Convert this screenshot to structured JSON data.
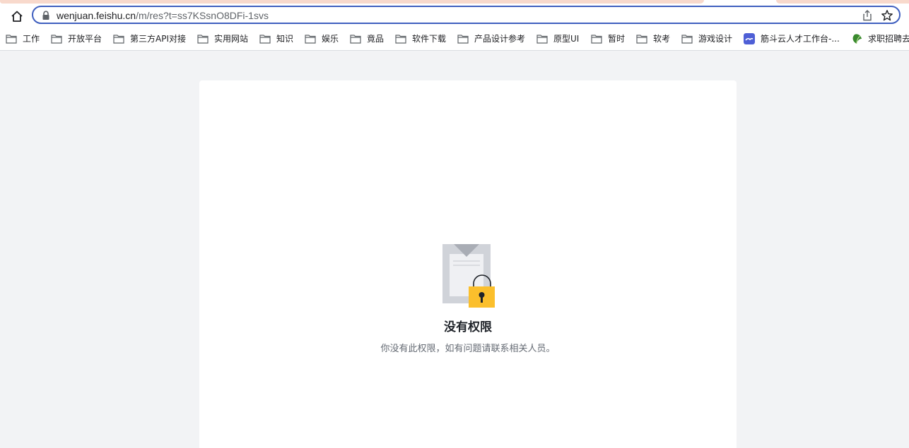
{
  "browser": {
    "url_host": "wenjuan.feishu.cn",
    "url_path": "/m/res?t=ss7KSsnO8DFi-1svs"
  },
  "bookmarks": [
    {
      "label": "工作",
      "icon": "folder-icon"
    },
    {
      "label": "开放平台",
      "icon": "folder-icon"
    },
    {
      "label": "第三方API对接",
      "icon": "folder-icon"
    },
    {
      "label": "实用网站",
      "icon": "folder-icon"
    },
    {
      "label": "知识",
      "icon": "folder-icon"
    },
    {
      "label": "娱乐",
      "icon": "folder-icon"
    },
    {
      "label": "竟品",
      "icon": "folder-icon"
    },
    {
      "label": "软件下载",
      "icon": "folder-icon"
    },
    {
      "label": "产品设计参考",
      "icon": "folder-icon"
    },
    {
      "label": "原型UI",
      "icon": "folder-icon"
    },
    {
      "label": "暂时",
      "icon": "folder-icon"
    },
    {
      "label": "软考",
      "icon": "folder-icon"
    },
    {
      "label": "游戏设计",
      "icon": "folder-icon"
    },
    {
      "label": "筋斗云人才工作台-...",
      "icon": "jindouyun-favicon",
      "color": "#4e5fd6"
    },
    {
      "label": "求职招聘去",
      "icon": "leaf-favicon",
      "color": "#3a8a2e"
    }
  ],
  "page": {
    "title": "没有权限",
    "description": "你没有此权限，如有问题请联系相关人员。"
  },
  "colors": {
    "accent_outline": "#3f5fbf",
    "content_bg": "#f2f3f5",
    "lock_yellow": "#fbbf2c",
    "title_text": "#1f2329",
    "desc_text": "#646a73"
  }
}
